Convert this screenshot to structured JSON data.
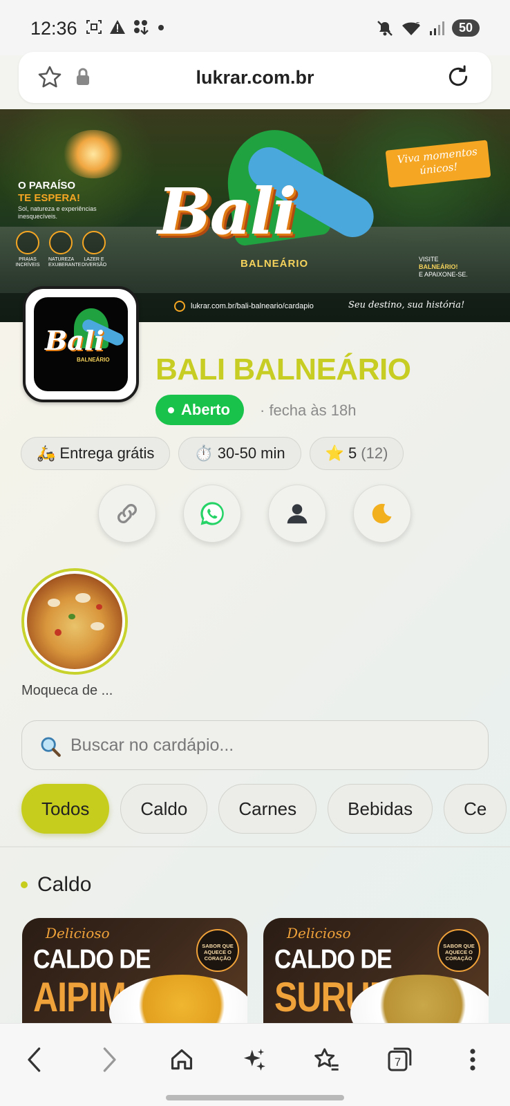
{
  "status_bar": {
    "time": "12:36",
    "battery": "50",
    "left_icons": [
      "screenshot-icon",
      "alert-icon",
      "apps-icon",
      "dot-icon"
    ],
    "right_icons": [
      "mute-icon",
      "wifi-icon",
      "signal-icon"
    ]
  },
  "browser": {
    "url": "lukrar.com.br",
    "bottom_nav": {
      "tabs_count": "7",
      "items": [
        "back-icon",
        "forward-icon",
        "home-icon",
        "ai-sparkle-icon",
        "bookmarks-icon",
        "tabs-icon",
        "more-icon"
      ]
    }
  },
  "banner": {
    "headline_1": "O PARAÍSO",
    "headline_2": "TE ESPERA!",
    "subtext": "Sol, natureza e experiências inesquecíveis.",
    "features": [
      "PRAIAS INCRÍVEIS",
      "NATUREZA EXUBERANTE",
      "LAZER E DIVERSÃO"
    ],
    "logo_word": "Bali",
    "logo_sub": "BALNEÁRIO",
    "tagline_badge": "Viva momentos únicos!",
    "visit_1": "VISITE",
    "visit_2": "BALNEÁRIO!",
    "visit_3": "E APAIXONE-SE.",
    "footer_url": "lukrar.com.br/bali-balneario/cardapio",
    "footer_tag": "Seu destino, sua história!"
  },
  "store": {
    "logo_word": "Bali",
    "logo_sub": "BALNEÁRIO",
    "name": "BALI BALNEÁRIO",
    "status": "Aberto",
    "closes": "· fecha às 18h",
    "chips": {
      "delivery_emoji": "🛵",
      "delivery": "Entrega grátis",
      "time_emoji": "⏱️",
      "time": "30-50 min",
      "rating_emoji": "⭐",
      "rating": "5",
      "rating_count": "(12)"
    },
    "actions": [
      "link-icon",
      "whatsapp-icon",
      "profile-icon",
      "dark-mode-icon"
    ]
  },
  "highlights": [
    {
      "label": "Moqueca de ..."
    }
  ],
  "search": {
    "placeholder": "Buscar no cardápio...",
    "value": ""
  },
  "categories": [
    "Todos",
    "Caldo",
    "Carnes",
    "Bebidas",
    "Ce"
  ],
  "active_category": "Todos",
  "section": {
    "title": "Caldo",
    "cards": [
      {
        "script": "Delicioso",
        "line1": "CALDO DE",
        "line2": "AIPIM",
        "seal": "SABOR QUE AQUECE O CORAÇÃO"
      },
      {
        "script": "Delicioso",
        "line1": "CALDO DE",
        "line2": "SURURU",
        "seal": "SABOR QUE AQUECE O CORAÇÃO"
      }
    ]
  },
  "colors": {
    "accent": "#c7cd1c",
    "open_green": "#19c24b",
    "card_orange": "#f0a23a"
  }
}
